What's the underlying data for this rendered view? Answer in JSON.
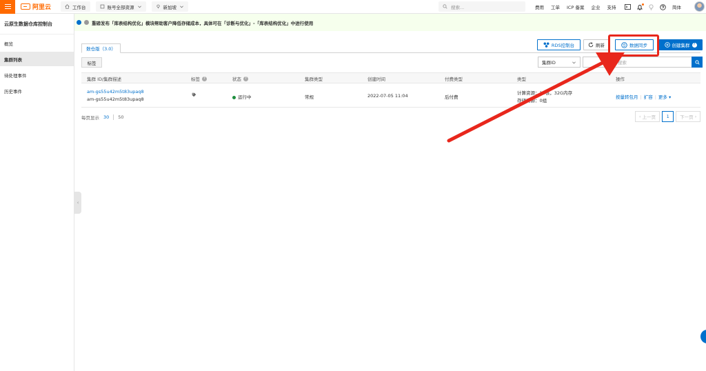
{
  "header": {
    "brand": "阿里云",
    "workbench": "工作台",
    "account_resources": "账号全部资源",
    "region": "新加坡",
    "search_placeholder": "搜索...",
    "links": [
      "费用",
      "工单",
      "ICP 备案",
      "企业",
      "支持"
    ],
    "language": "简体"
  },
  "sidebar": {
    "title": "云原生数据仓库控制台",
    "items": [
      {
        "label": "概览"
      },
      {
        "label": "集群列表"
      },
      {
        "label": "待处理事件"
      },
      {
        "label": "历史事件"
      }
    ]
  },
  "banner": {
    "text": "重磅发布「库表结构优化」模块帮助客户降低存储成本，具体可在「诊断与优化」-「库表结构优化」中进行使用"
  },
  "toolbar": {
    "tab_label": "数仓版（3.0）",
    "rds_console": "RDS控制台",
    "refresh": "刷新",
    "data_sync": "数据同步",
    "create_cluster": "创建集群",
    "tag_button": "标签",
    "search_field": "集群ID",
    "search_placeholder": "ID进行搜索"
  },
  "table": {
    "columns": [
      "集群 ID/集群描述",
      "标签",
      "状态",
      "集群类型",
      "创建时间",
      "付费类型",
      "类型",
      "操作"
    ],
    "rows": [
      {
        "cluster_id": "am-gs55u42m5t83upaq8",
        "description": "am-gs55u42m5t83upaq8",
        "status": "运行中",
        "cluster_type": "常规",
        "created": "2022-07-05 11:04",
        "billing": "后付费",
        "type_line1": "计算资源：16核，32G内存",
        "type_line2": "存储资源：0组",
        "actions": [
          "按量转包月",
          "扩容",
          "更多"
        ]
      }
    ]
  },
  "pagination": {
    "per_page_label": "每页显示",
    "sizes": [
      "30",
      "50"
    ],
    "prev": "上一页",
    "current": "1",
    "next": "下一页"
  },
  "colors": {
    "brand": "#ff6a00",
    "primary": "#0070cc",
    "annotation": "#e8271c",
    "banner_bg": "#f6ffed"
  }
}
